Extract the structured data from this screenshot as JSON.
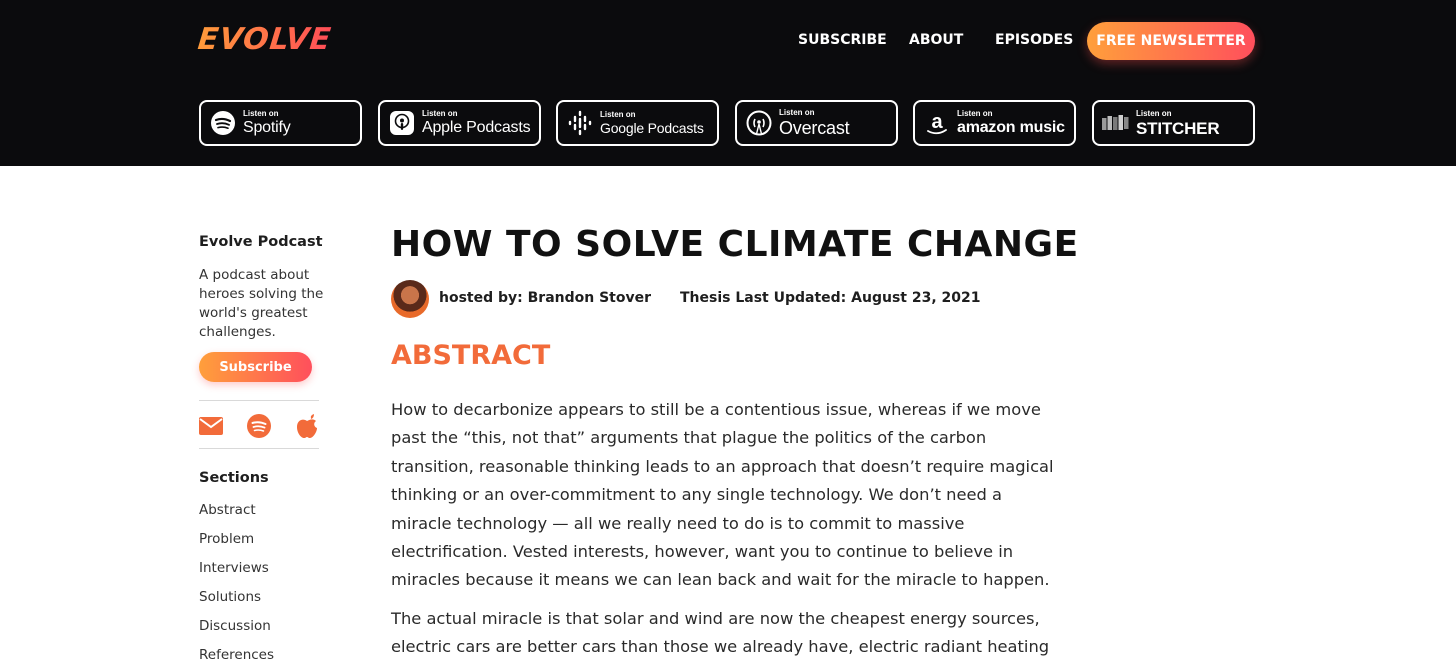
{
  "header": {
    "logo": "EVOLVE",
    "nav": [
      "SUBSCRIBE",
      "ABOUT",
      "EPISODES"
    ],
    "newsletter_button": "FREE NEWSLETTER",
    "platforms": [
      {
        "listen": "Listen on",
        "name": "Spotify",
        "icon": "spotify-icon"
      },
      {
        "listen": "Listen on",
        "name": "Apple Podcasts",
        "icon": "apple-podcasts-icon"
      },
      {
        "listen": "Listen on",
        "name": "Google Podcasts",
        "icon": "google-podcasts-icon"
      },
      {
        "listen": "Listen on",
        "name": "Overcast",
        "icon": "overcast-icon"
      },
      {
        "listen": "Listen on",
        "name": "amazon music",
        "icon": "amazon-icon"
      },
      {
        "listen": "Listen on",
        "name": "STITCHER",
        "icon": "stitcher-icon"
      }
    ]
  },
  "sidebar": {
    "title": "Evolve Podcast",
    "description": "A podcast about heroes solving the world's greatest challenges.",
    "subscribe_button": "Subscribe",
    "icons": [
      "email-icon",
      "spotify-icon",
      "apple-icon"
    ],
    "sections_title": "Sections",
    "sections": [
      "Abstract",
      "Problem",
      "Interviews",
      "Solutions",
      "Discussion",
      "References"
    ]
  },
  "main": {
    "title": "HOW TO SOLVE CLIMATE CHANGE",
    "hosted_by": "hosted by: Brandon Stover",
    "updated": "Thesis Last Updated: August 23, 2021",
    "abstract_heading": "ABSTRACT",
    "paragraphs": [
      "How to decarbonize appears to still be a contentious issue, whereas if we move past the “this, not that” arguments that plague the politics of the carbon transition, reasonable thinking leads to an approach that doesn’t require magical thinking or an over-commitment to any single technology. We don’t need a miracle technology — all we really need to do is to commit to massive electrification. Vested interests, however, want you to continue to believe in miracles because it means we can lean back and wait for the miracle to happen.",
      "The actual miracle is that solar and wind are now the cheapest energy sources, electric cars are better cars than those we already have, electric radiant heating is"
    ]
  },
  "colors": {
    "header_bg": "#0b0b0d",
    "accent_orange": "#f26b3a",
    "gradient_start": "#ff9f3b",
    "gradient_end": "#ff4f5c"
  }
}
